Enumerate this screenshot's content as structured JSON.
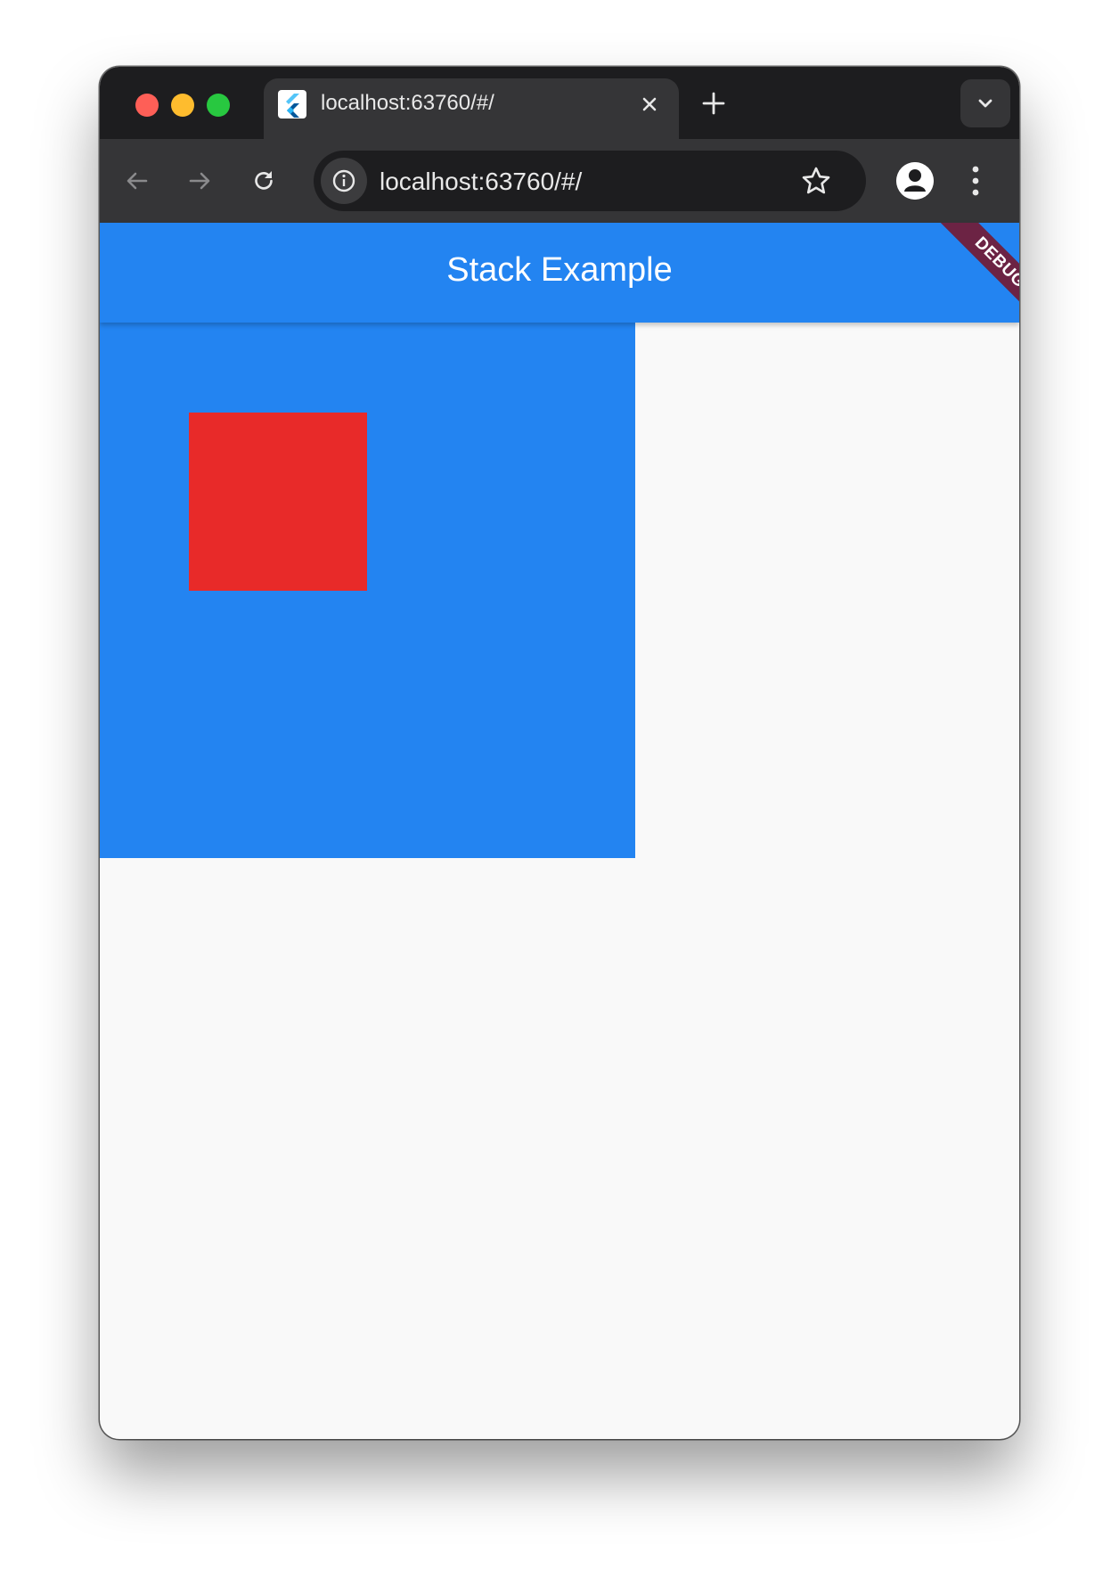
{
  "browser": {
    "tab": {
      "title": "localhost:63760/#/",
      "favicon": "flutter-icon"
    },
    "address_bar": {
      "url": "localhost:63760/#/"
    },
    "icons": {
      "close": "close-icon",
      "new_tab": "plus-icon",
      "tab_search": "chevron-down-icon",
      "back": "arrow-left-icon",
      "forward": "arrow-right-icon",
      "reload": "reload-icon",
      "site_info": "info-icon",
      "bookmark": "star-icon",
      "profile": "person-icon",
      "menu": "more-vert-icon"
    }
  },
  "app": {
    "appbar": {
      "title": "Stack Example"
    },
    "debug_banner": {
      "label": "DEBUG"
    }
  },
  "colors": {
    "primary_blue": "#2384f1",
    "red_box": "#e82a29",
    "debug_ribbon": "#6c2344",
    "page_background": "#f9f9f9"
  }
}
